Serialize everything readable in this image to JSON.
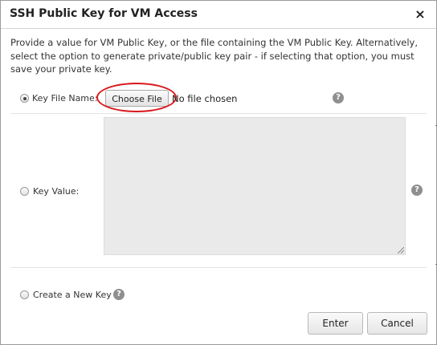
{
  "dialog": {
    "title": "SSH Public Key for VM Access",
    "close_label": "×",
    "description": "Provide a value for VM Public Key, or the file containing the VM Public Key. Alternatively, select the option to generate private/public key pair - if selecting that option, you must save your private key."
  },
  "options": {
    "key_file": {
      "label": "Key File Name:",
      "selected": true,
      "button_label": "Choose File",
      "file_status": "No file chosen",
      "help": "?"
    },
    "key_value": {
      "label": "Key Value:",
      "selected": false,
      "value": "",
      "help": "?"
    },
    "new_key": {
      "label": "Create a New Key",
      "selected": false,
      "help": "?"
    }
  },
  "footer": {
    "enter_label": "Enter",
    "cancel_label": "Cancel"
  },
  "colors": {
    "annotation": "#d9171b",
    "textarea_bg": "#eaeaea",
    "help_icon": "#8f8f8f"
  }
}
